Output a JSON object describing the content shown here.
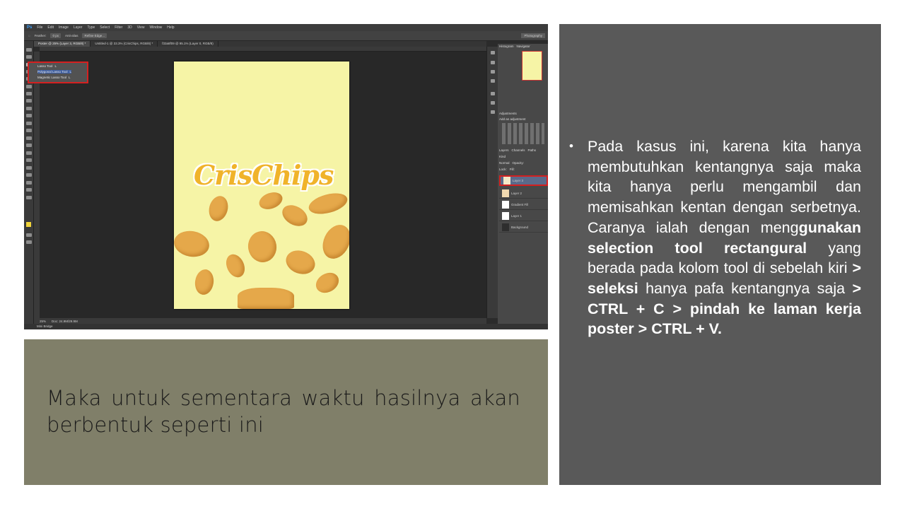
{
  "photoshop": {
    "logo": "Ps",
    "menu": [
      "File",
      "Edit",
      "Image",
      "Layer",
      "Type",
      "Select",
      "Filter",
      "3D",
      "View",
      "Window",
      "Help"
    ],
    "options": {
      "feather_label": "Feather:",
      "feather_value": "0 px",
      "antialias_label": "Anti-alias",
      "refine_label": "Refine Edge..."
    },
    "workspace": "Photography",
    "tabs": [
      "Poster @ 25% (Layer 3, RGB/8) *",
      "Untitled-1 @ 33.3% (CrisChips, RGB/8) *",
      "f33a8f09 @ 95.1% (Layer 0, RGB/8)"
    ],
    "lasso_menu": [
      {
        "label": "Lasso Tool",
        "key": "L"
      },
      {
        "label": "Polygonal Lasso Tool",
        "key": "L"
      },
      {
        "label": "Magnetic Lasso Tool",
        "key": "L"
      }
    ],
    "poster_logo": "CrisChips",
    "status": {
      "zoom": "25%",
      "doc": "Doc: 24.9M/29.9M"
    },
    "minibridge": "Mini Bridge",
    "panel_tabs": {
      "top": [
        "Histogram",
        "Navigator"
      ],
      "adjust": [
        "Adjustments"
      ],
      "adjust_hint": "Add an adjustment",
      "layers": [
        "Layers",
        "Channels",
        "Paths"
      ]
    },
    "layer_controls": {
      "kind": "Kind",
      "blend": "Normal",
      "opacity": "Opacity:",
      "lock": "Lock:",
      "fill": "Fill:"
    },
    "layers": [
      "Layer 3",
      "Layer 2",
      "Gradient Fill",
      "Layer 1",
      "Background"
    ]
  },
  "right_panel": {
    "bullet": "•",
    "segments": [
      {
        "text": "Pada kasus ini, karena kita hanya membutuhkan kentangnya saja maka kita hanya perlu mengambil dan memisahkan kentan dengan serbetnya. Caranya ialah dengan meng",
        "bold": false
      },
      {
        "text": "gunakan selection tool rectangural",
        "bold": true
      },
      {
        "text": " yang berada pada kolom tool di sebelah kiri ",
        "bold": false
      },
      {
        "text": "> seleksi",
        "bold": true
      },
      {
        "text": " hanya pafa kentangnya saja ",
        "bold": false
      },
      {
        "text": "> CTRL + C > pindah ke laman kerja poster > CTRL + V.",
        "bold": true
      }
    ]
  },
  "caption": {
    "text": "Maka untuk sementara waktu hasilnya akan berbentuk seperti ini"
  },
  "colors": {
    "right_panel_bg": "#595959",
    "caption_bg": "#807f69",
    "poster_bg": "#f6f4a6",
    "highlight_red": "#d42020",
    "chip": "#e5a84a",
    "logo_orange": "#f0b32a"
  }
}
